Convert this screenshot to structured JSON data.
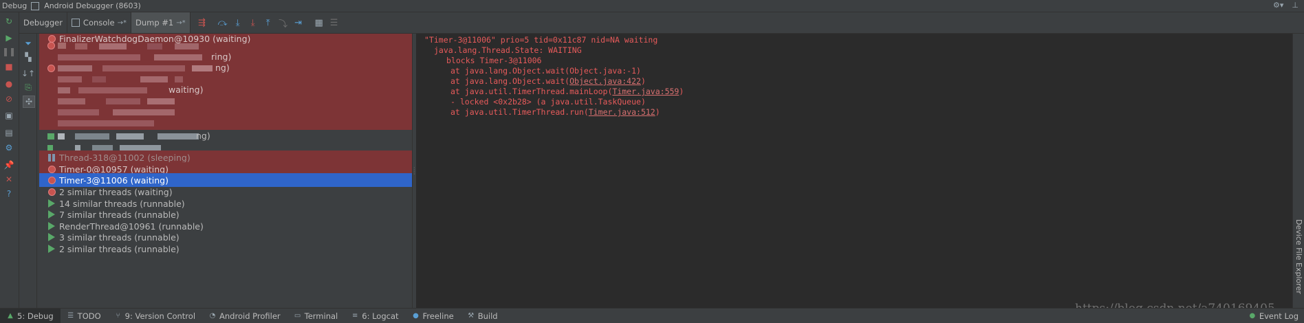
{
  "window": {
    "debug_label": "Debug",
    "session_label": "Android Debugger (8603)"
  },
  "tabs": [
    {
      "label": "Debugger"
    },
    {
      "label": "Console",
      "pin": "→*"
    },
    {
      "label": "Dump #1",
      "pin": "→*"
    }
  ],
  "threads": {
    "finalizer": "FinalizerWatchdogDaemon@10930 (waiting)",
    "thread318": "Thread-318@11002 (sleeping)",
    "timer0": "Timer-0@10957 (waiting)",
    "timer3": "Timer-3@11006 (waiting)",
    "similar_waiting": "2 similar threads (waiting)",
    "similar_14": "14 similar threads (runnable)",
    "similar_7": "7 similar threads (runnable)",
    "render": "RenderThread@10961 (runnable)",
    "similar_3": "3 similar threads (runnable)",
    "similar_2": "2 similar threads (runnable)",
    "obscured_fragments": [
      "ring)",
      "ng)",
      "waiting)",
      "ng)"
    ]
  },
  "dump": {
    "l1": "\"Timer-3@11006\" prio=5 tid=0x11c87 nid=NA waiting",
    "l2": "java.lang.Thread.State: WAITING",
    "l3": "blocks Timer-3@11006",
    "l4": "at java.lang.Object.wait(Object.java:-1)",
    "l5_pre": "at java.lang.Object.wait(",
    "l5_link": "Object.java:422",
    "l5_post": ")",
    "l6_pre": "at java.util.TimerThread.mainLoop(",
    "l6_link": "Timer.java:559",
    "l6_post": ")",
    "l7": "- locked <0x2b28> (a java.util.TaskQueue)",
    "l8_pre": "at java.util.TimerThread.run(",
    "l8_link": "Timer.java:512",
    "l8_post": ")"
  },
  "right_panel": {
    "label": "Device File Explorer"
  },
  "statusbar": {
    "items": [
      {
        "label": "5: Debug"
      },
      {
        "label": "TODO"
      },
      {
        "label": "9: Version Control"
      },
      {
        "label": "Android Profiler"
      },
      {
        "label": "Terminal"
      },
      {
        "label": "6: Logcat"
      },
      {
        "label": "Freeline"
      },
      {
        "label": "Build"
      }
    ],
    "event_log": "Event Log"
  },
  "watermark": "https://blog.csdn.net/a740169405",
  "colors": {
    "background": "#2b2b2b",
    "panel": "#3c3f41",
    "highlight_red": "#7d3436",
    "selection": "#2f65ca",
    "dump_text": "#e85b5b"
  },
  "icons": [
    "debug-icon",
    "rerun-icon",
    "resume-icon",
    "pause-icon",
    "stop-icon",
    "breakpoints-icon",
    "mute-icon",
    "filter-icon",
    "sort-icon",
    "export-icon",
    "step-over-icon",
    "step-into-icon",
    "force-step-into-icon",
    "step-out-icon",
    "run-to-cursor-icon",
    "evaluate-icon",
    "frames-icon",
    "settings-icon",
    "pin-icon",
    "close-icon",
    "help-icon"
  ]
}
